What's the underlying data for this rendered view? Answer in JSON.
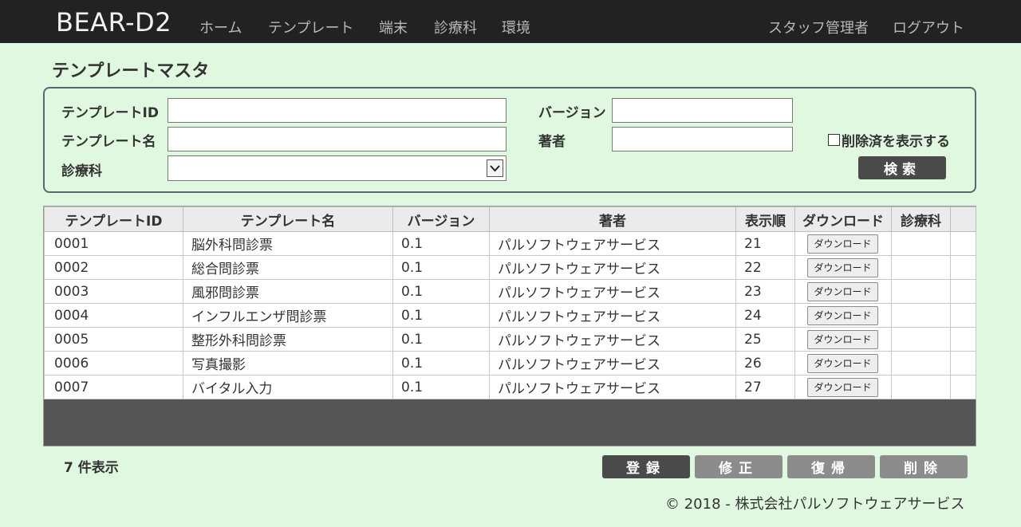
{
  "app": {
    "brand": "BEAR-D2",
    "nav": [
      "ホーム",
      "テンプレート",
      "端末",
      "診療科",
      "環境"
    ],
    "user": "スタッフ管理者",
    "logout": "ログアウト"
  },
  "page": {
    "title": "テンプレートマスタ"
  },
  "search": {
    "template_id_label": "テンプレートID",
    "template_id_value": "",
    "template_name_label": "テンプレート名",
    "template_name_value": "",
    "department_label": "診療科",
    "department_selected": "",
    "version_label": "バージョン",
    "version_value": "",
    "author_label": "著者",
    "author_value": "",
    "show_deleted_label": "削除済を表示する",
    "show_deleted_checked": false,
    "search_button": "検索"
  },
  "table": {
    "columns": [
      "テンプレートID",
      "テンプレート名",
      "バージョン",
      "著者",
      "表示順",
      "ダウンロード",
      "診療科",
      ""
    ],
    "download_label": "ダウンロード",
    "rows": [
      {
        "id": "0001",
        "name": "脳外科問診票",
        "version": "0.1",
        "author": "パルソフトウェアサービス",
        "order": "21",
        "department": ""
      },
      {
        "id": "0002",
        "name": "総合問診票",
        "version": "0.1",
        "author": "パルソフトウェアサービス",
        "order": "22",
        "department": ""
      },
      {
        "id": "0003",
        "name": "風邪問診票",
        "version": "0.1",
        "author": "パルソフトウェアサービス",
        "order": "23",
        "department": ""
      },
      {
        "id": "0004",
        "name": "インフルエンザ問診票",
        "version": "0.1",
        "author": "パルソフトウェアサービス",
        "order": "24",
        "department": ""
      },
      {
        "id": "0005",
        "name": "整形外科問診票",
        "version": "0.1",
        "author": "パルソフトウェアサービス",
        "order": "25",
        "department": ""
      },
      {
        "id": "0006",
        "name": "写真撮影",
        "version": "0.1",
        "author": "パルソフトウェアサービス",
        "order": "26",
        "department": ""
      },
      {
        "id": "0007",
        "name": "バイタル入力",
        "version": "0.1",
        "author": "パルソフトウェアサービス",
        "order": "27",
        "department": ""
      }
    ]
  },
  "footer": {
    "count_text": "7 件表示",
    "register_button": "登録",
    "edit_button": "修正",
    "restore_button": "復帰",
    "delete_button": "削除",
    "copyright": "© 2018 - 株式会社パルソフトウェアサービス"
  },
  "colors": {
    "page_bg": "#dff8df",
    "navbar_bg": "#222222",
    "dark_button": "#4a4a4a",
    "gray_button": "#8c8c8c",
    "grid_bg": "#555555"
  }
}
